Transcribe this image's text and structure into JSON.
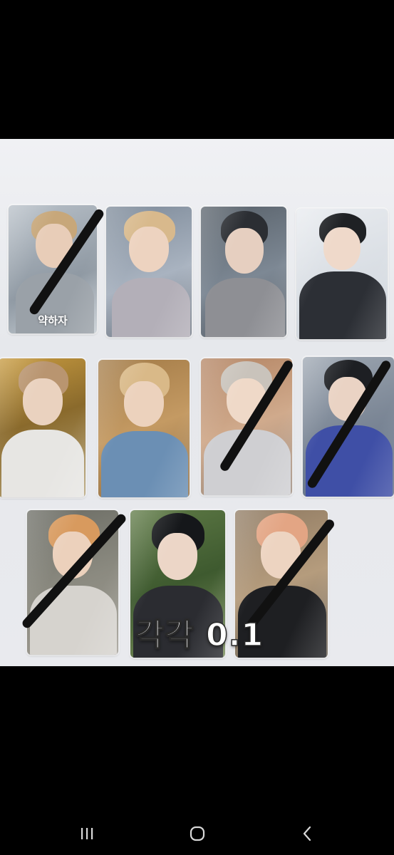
{
  "photo": {
    "price_text": "각각 0.1",
    "cards": [
      {
        "id": 1,
        "label": "약하자",
        "crossed": true
      },
      {
        "id": 2,
        "label": "",
        "crossed": false
      },
      {
        "id": 3,
        "label": "",
        "crossed": false
      },
      {
        "id": 4,
        "label": "",
        "crossed": false
      },
      {
        "id": 5,
        "label": "",
        "crossed": false
      },
      {
        "id": 6,
        "label": "",
        "crossed": false
      },
      {
        "id": 7,
        "label": "",
        "crossed": true
      },
      {
        "id": 8,
        "label": "",
        "crossed": true
      },
      {
        "id": 9,
        "label": "",
        "crossed": true
      },
      {
        "id": 10,
        "label": "",
        "crossed": false
      },
      {
        "id": 11,
        "label": "",
        "crossed": true
      }
    ]
  },
  "navbar": {
    "recents_icon": "recents-icon",
    "home_icon": "home-icon",
    "back_icon": "back-icon"
  }
}
